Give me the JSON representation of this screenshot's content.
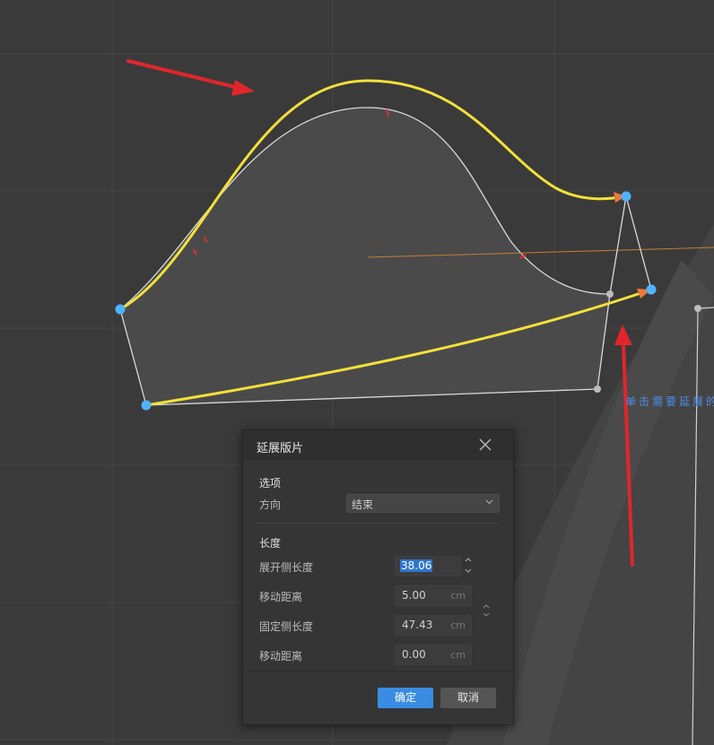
{
  "canvas": {
    "hint_text": "单击需要延展的",
    "colors": {
      "background": "#3a3a3a",
      "grid": "#474747",
      "piece_fill": "#4a4a4a",
      "piece_outline": "#d9d9d9",
      "highlight_curve": "#f2e03a",
      "annotation_arrow": "#e0262b",
      "control_point": "#4fb3ff",
      "orange_line": "#c87b34"
    }
  },
  "dialog": {
    "title": "延展版片",
    "close_icon": "close-icon",
    "options_section": "选项",
    "direction_label": "方向",
    "direction_value": "结束",
    "length_section": "长度",
    "rows": [
      {
        "label": "展开侧长度",
        "value": "38.06",
        "unit": ""
      },
      {
        "label": "移动距离",
        "value": "5.00",
        "unit": "cm"
      },
      {
        "label": "固定侧长度",
        "value": "47.43",
        "unit": "cm"
      },
      {
        "label": "移动距离",
        "value": "0.00",
        "unit": "cm"
      }
    ],
    "ok_label": "确定",
    "cancel_label": "取消"
  }
}
